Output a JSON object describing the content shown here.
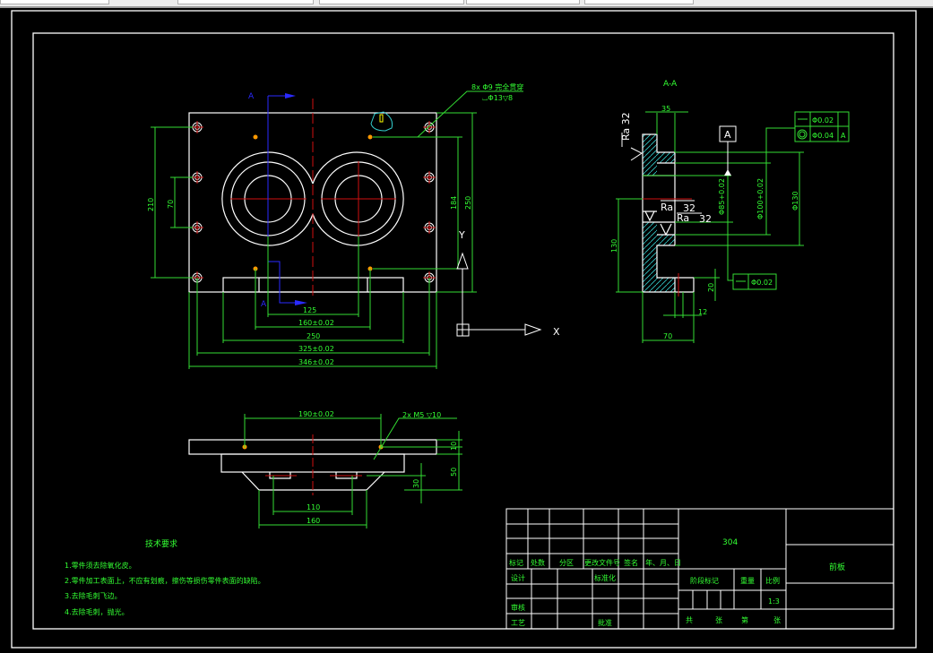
{
  "colors": {
    "background": "#000000",
    "dimension": "#33ff33",
    "object": "#ffffff",
    "centerline": "#d01010",
    "section_line": "#2a2aff"
  },
  "front_view": {
    "section_label_top": "A",
    "section_label_bottom": "A",
    "hole_note_line1": "8x Φ9 完全贯穿",
    "hole_note_line2": "⌴Φ13▽8",
    "dim_125": "125",
    "dim_160": "160±0.02",
    "dim_250": "250",
    "dim_325": "325±0.02",
    "dim_346": "346±0.02",
    "dim_210": "210",
    "dim_70": "70",
    "dim_184": "184",
    "dim_250_v": "250"
  },
  "ucs": {
    "x_label": "X",
    "y_label": "Y",
    "icon": "ucs-icon"
  },
  "section_view": {
    "title": "A-A",
    "dim_35": "35",
    "dim_130": "130",
    "dim_20": "20",
    "dim_12": "12",
    "dim_70": "70",
    "dim_d85": "Φ85+0.02",
    "dim_d100": "Φ100+0.02",
    "dim_d130": "Φ130",
    "ra1": "Ra 32",
    "ra2": "Ra",
    "ra2_value": "32",
    "ra3": "Ra",
    "ra3_value": "32",
    "datum": "A",
    "tol_flatness": "Φ0.02",
    "tol_concentric": "Φ0.04",
    "tol_concentric_datum": "A",
    "tol_bottom": "Φ0.02"
  },
  "side_view": {
    "dim_190": "190±0.02",
    "thread_note": "2x M5 ▽10",
    "dim_10": "10",
    "dim_50": "50",
    "dim_30": "30",
    "dim_110": "110",
    "dim_160": "160"
  },
  "tech_requirements": {
    "title": "技术要求",
    "items": [
      "1.零件须去除氧化皮。",
      "2.零件加工表面上，不应有划痕，擦伤等损伤零件表面的缺陷。",
      "3.去除毛刺飞边。",
      "4.去除毛刺，抛光。"
    ]
  },
  "title_block": {
    "material": "304",
    "part_name": "前板",
    "scale": "1:3",
    "headers": [
      "标记",
      "处数",
      "分区",
      "更改文件号",
      "签名",
      "年、月、日"
    ],
    "design": "设计",
    "standardization": "标准化",
    "review": "审核",
    "process": "工艺",
    "approve": "批准",
    "stage_mark": "阶段标记",
    "weight": "重量",
    "ratio": "比例",
    "total": "共",
    "sheets": "张",
    "page": "第",
    "sheet2": "张"
  }
}
